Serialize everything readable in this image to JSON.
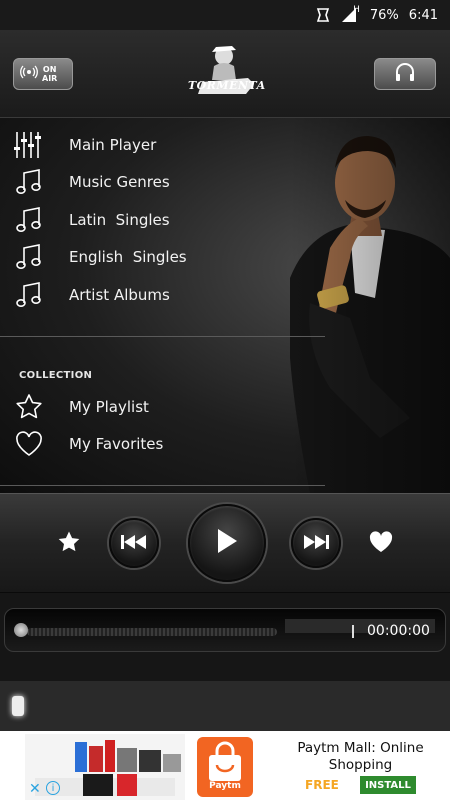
{
  "status_bar": {
    "network": "H",
    "battery": "76%",
    "time": "6:41"
  },
  "header": {
    "onair_label_1": "ON",
    "onair_label_2": "AIR",
    "logo_text": "TORMENTA"
  },
  "menu": {
    "items": [
      {
        "label": "Main Player",
        "icon": "equalizer-icon"
      },
      {
        "label": "Music Genres",
        "icon": "music-note-icon"
      },
      {
        "label": "Latin  Singles",
        "icon": "music-note-icon"
      },
      {
        "label": "English  Singles",
        "icon": "music-note-icon"
      },
      {
        "label": "Artist Albums",
        "icon": "music-note-icon"
      }
    ],
    "collection_title": "COLLECTION",
    "collection_items": [
      {
        "label": "My Playlist",
        "icon": "star-outline-icon"
      },
      {
        "label": "My Favorites",
        "icon": "heart-outline-icon"
      }
    ]
  },
  "player": {
    "elapsed": "00:00:00",
    "progress": 0
  },
  "ad": {
    "title": "Paytm Mall: Online Shopping",
    "free_label": "FREE",
    "install_label": "INSTALL",
    "brand": "Paytm",
    "close_glyph": "✕",
    "info_glyph": "i"
  },
  "colors": {
    "accent": "#ffffff",
    "ad_install": "#2e8b2e",
    "ad_free": "#f5a623"
  }
}
